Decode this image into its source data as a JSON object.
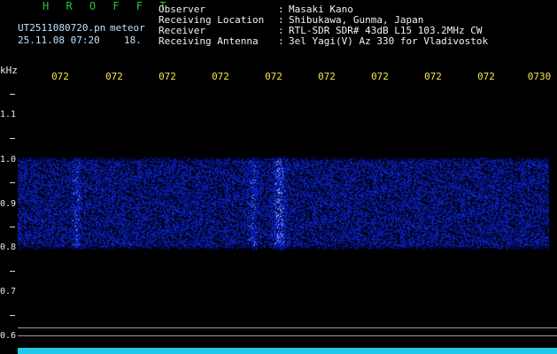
{
  "header": {
    "app_name": "H R O F F T",
    "filename": "UT2511080720.pn",
    "category": "meteor",
    "datetime": "25.11.08 07:20",
    "count": "18.",
    "meta": [
      {
        "label": "Observer",
        "value": "Masaki Kano"
      },
      {
        "label": "Receiving Location",
        "value": "Shibukawa, Gunma, Japan"
      },
      {
        "label": "Receiver",
        "value": "RTL-SDR SDR# 43dB L15 103.2MHz CW"
      },
      {
        "label": "Receiving Antenna",
        "value": "3el Yagi(V) Az 330 for Vladivostok"
      }
    ],
    "colon": ":"
  },
  "time_axis": {
    "ticks": [
      "072",
      "072",
      "072",
      "072",
      "072",
      "072",
      "072",
      "072",
      "072",
      "0730"
    ]
  },
  "freq_axis": {
    "unit": "kHz",
    "ticks": [
      "1.1",
      "1.0",
      "0.9",
      "0.8",
      "0.7",
      "0.6"
    ]
  },
  "spectrogram": {
    "signal_color": "#2850ff",
    "band_khz": [
      0.81,
      1.01
    ],
    "trace_color": "#1ec8e6"
  }
}
